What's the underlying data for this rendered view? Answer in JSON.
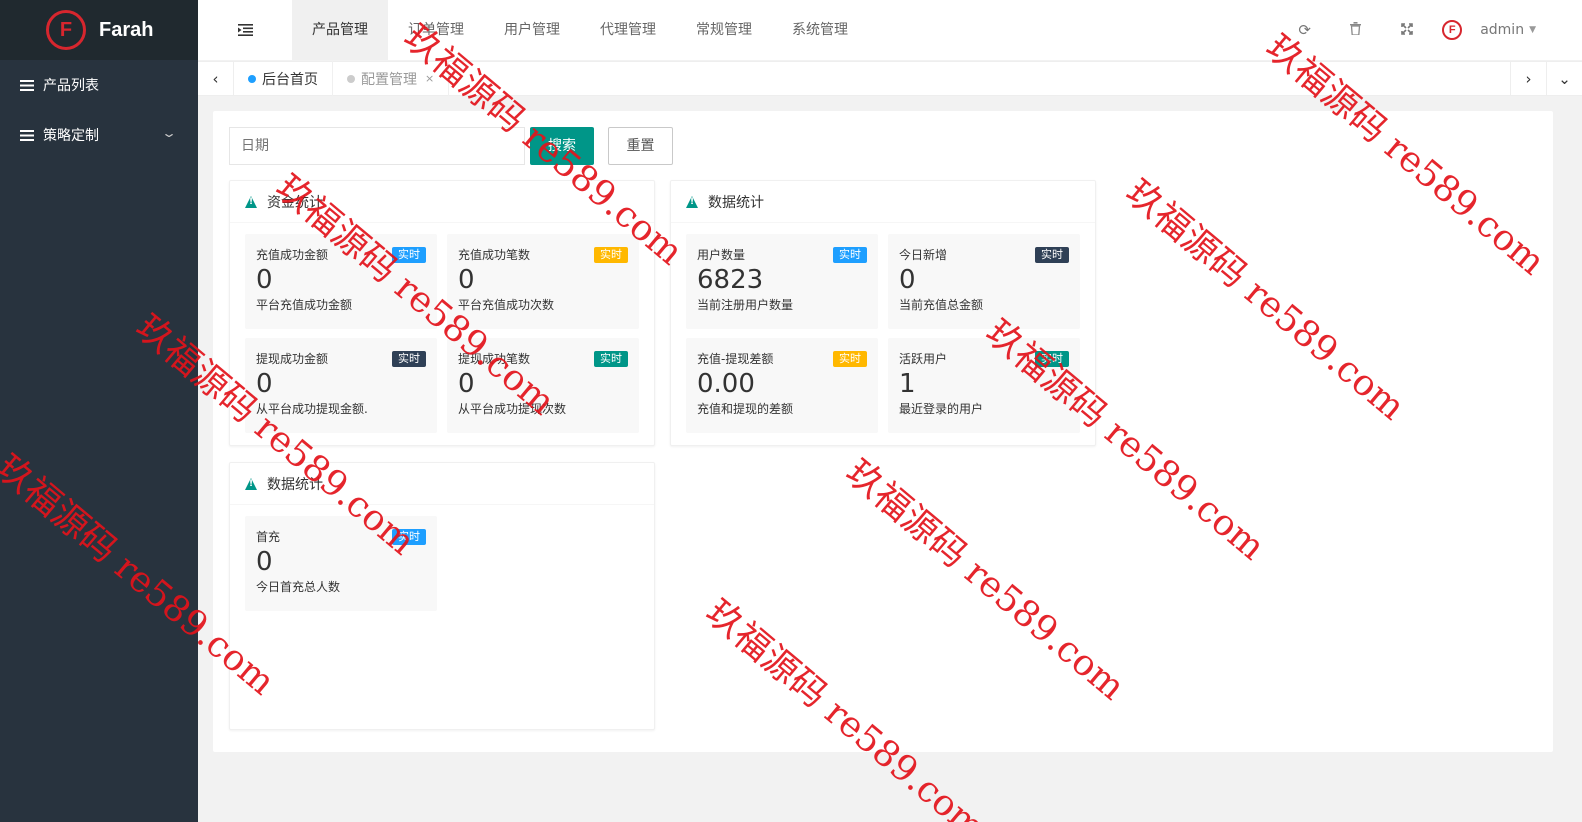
{
  "app": {
    "name": "Farah",
    "logo_letter": "F"
  },
  "sidebar": {
    "items": [
      {
        "label": "产品列表",
        "icon": "list-icon"
      },
      {
        "label": "策略定制",
        "icon": "list-icon",
        "chevron": "chevron-down-icon"
      }
    ]
  },
  "topnav": {
    "fold_icon": "menu-fold-icon",
    "tabs": [
      "产品管理",
      "订单管理",
      "用户管理",
      "代理管理",
      "常规管理",
      "系统管理"
    ],
    "active": 0
  },
  "toolbar": {
    "icons": [
      "refresh-icon",
      "trash-icon",
      "fullscreen-icon"
    ],
    "user": "admin",
    "avatar_letter": "F"
  },
  "page_tabs": [
    {
      "label": "后台首页",
      "active": true
    },
    {
      "label": "配置管理",
      "active": false,
      "close": "×"
    }
  ],
  "filter": {
    "date_placeholder": "日期",
    "search_label": "搜索",
    "reset_label": "重置"
  },
  "cards": [
    {
      "title": "资金统计",
      "stats": [
        {
          "title": "充值成功金额",
          "value": "0",
          "desc": "平台充值成功金额",
          "badge": "实时",
          "color": "#1e9fff"
        },
        {
          "title": "充值成功笔数",
          "value": "0",
          "desc": "平台充值成功次数",
          "badge": "实时",
          "color": "#ffb800"
        },
        {
          "title": "提现成功金额",
          "value": "0",
          "desc": "从平台成功提现金额.",
          "badge": "实时",
          "color": "#2f4056"
        },
        {
          "title": "提现成功笔数",
          "value": "0",
          "desc": "从平台成功提现次数",
          "badge": "实时",
          "color": "#009688"
        }
      ]
    },
    {
      "title": "数据统计",
      "stats": [
        {
          "title": "用户数量",
          "value": "6823",
          "desc": "当前注册用户数量",
          "badge": "实时",
          "color": "#1e9fff"
        },
        {
          "title": "今日新增",
          "value": "0",
          "desc": "当前充值总金额",
          "badge": "实时",
          "color": "#2f4056"
        },
        {
          "title": "充值-提现差额",
          "value": "0.00",
          "desc": "充值和提现的差额",
          "badge": "实时",
          "color": "#ffb800"
        },
        {
          "title": "活跃用户",
          "value": "1",
          "desc": "最近登录的用户",
          "badge": "实时",
          "color": "#009688"
        }
      ]
    },
    {
      "title": "数据统计",
      "stats": [
        {
          "title": "首充",
          "value": "0",
          "desc": "今日首充总人数",
          "badge": "实时",
          "color": "#1e9fff"
        }
      ]
    }
  ],
  "watermark": "玖福源码 re589.com"
}
